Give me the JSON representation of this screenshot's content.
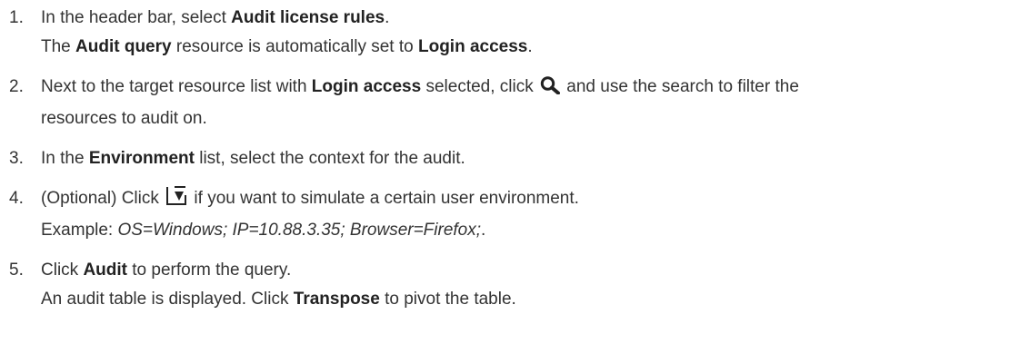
{
  "steps": [
    {
      "number": "1.",
      "line1": {
        "t1": "In the header bar, select ",
        "b1": "Audit license rules",
        "t2": "."
      },
      "line2": {
        "t1": "The ",
        "b1": "Audit query",
        "t2": " resource is automatically set to ",
        "b2": "Login access",
        "t3": "."
      }
    },
    {
      "number": "2.",
      "line1": {
        "t1": "Next to the target resource list with ",
        "b1": "Login access",
        "t2": " selected, click ",
        "icon": "search-icon",
        "t3": " and use the search to filter the"
      },
      "line2": {
        "t1": "resources to audit on."
      }
    },
    {
      "number": "3.",
      "line1": {
        "t1": "In the ",
        "b1": "Environment",
        "t2": " list, select the context for the audit."
      }
    },
    {
      "number": "4.",
      "line1": {
        "t1": "(Optional) Click ",
        "icon": "simulate-environment-icon",
        "t2": " if you want to simulate a certain user environment."
      },
      "line2": {
        "t1": "Example: ",
        "i1": "OS=Windows; IP=10.88.3.35; Browser=Firefox;",
        "t2": "."
      }
    },
    {
      "number": "5.",
      "line1": {
        "t1": "Click ",
        "b1": "Audit",
        "t2": " to perform the query."
      },
      "line2": {
        "t1": "An audit table is displayed. Click ",
        "b1": "Transpose",
        "t2": " to pivot the table."
      }
    }
  ]
}
